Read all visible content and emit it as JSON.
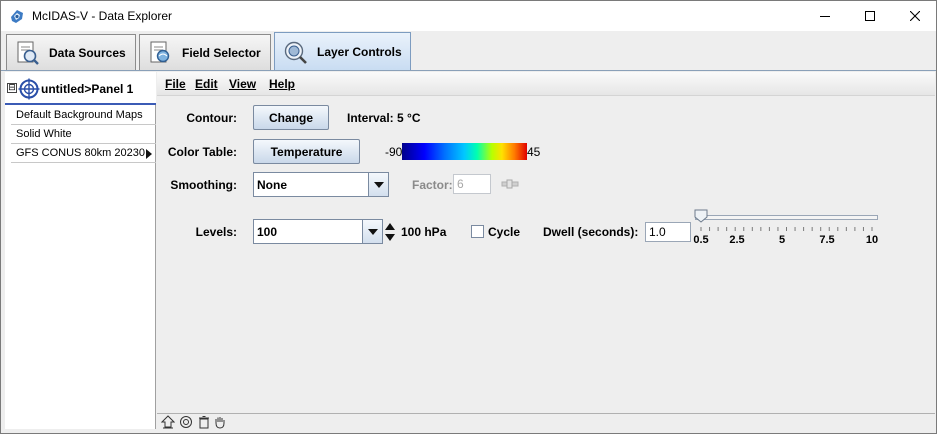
{
  "window": {
    "title": "McIDAS-V - Data Explorer",
    "controls": {
      "minimize": "minimize-icon",
      "maximize": "maximize-icon",
      "close": "close-icon"
    }
  },
  "tabs": [
    {
      "label": "Data Sources",
      "icon": "data-sources-icon",
      "active": false
    },
    {
      "label": "Field Selector",
      "icon": "field-selector-icon",
      "active": false
    },
    {
      "label": "Layer Controls",
      "icon": "layer-controls-icon",
      "active": true
    }
  ],
  "panel": {
    "expander": "⊟",
    "title": "untitled>Panel 1",
    "layers": [
      {
        "label": "Default Background Maps"
      },
      {
        "label": "Solid White"
      },
      {
        "label": "GFS CONUS 80km 20230."
      }
    ]
  },
  "menu": {
    "file": "File",
    "edit": "Edit",
    "view": "View",
    "help": "Help"
  },
  "controls": {
    "contour": {
      "label": "Contour:",
      "button": "Change",
      "interval": "Interval: 5 °C"
    },
    "color_table": {
      "label": "Color Table:",
      "button": "Temperature",
      "min": "-90",
      "max": "45"
    },
    "smoothing": {
      "label": "Smoothing:",
      "value": "None",
      "factor_label": "Factor:",
      "factor_value": "6"
    },
    "levels": {
      "label": "Levels:",
      "value": "100",
      "current": "100 hPa"
    },
    "cycle": {
      "label": "Cycle",
      "checked": false
    },
    "dwell": {
      "label": "Dwell (seconds):",
      "value": "1.0",
      "slider_value": 0.5,
      "slider_min": 0.5,
      "slider_max": 10,
      "ticks": [
        "0.5",
        "2.5",
        "5",
        "7.5",
        "10"
      ]
    }
  },
  "statusbar": {
    "icons": [
      "remove-layer-icon",
      "display-properties-icon",
      "trash-icon",
      "hand-icon"
    ]
  },
  "colors": {
    "active_tab": "#c8dcf2",
    "button": "#c9d8ea",
    "panel_underline": "#3b5bb5"
  }
}
